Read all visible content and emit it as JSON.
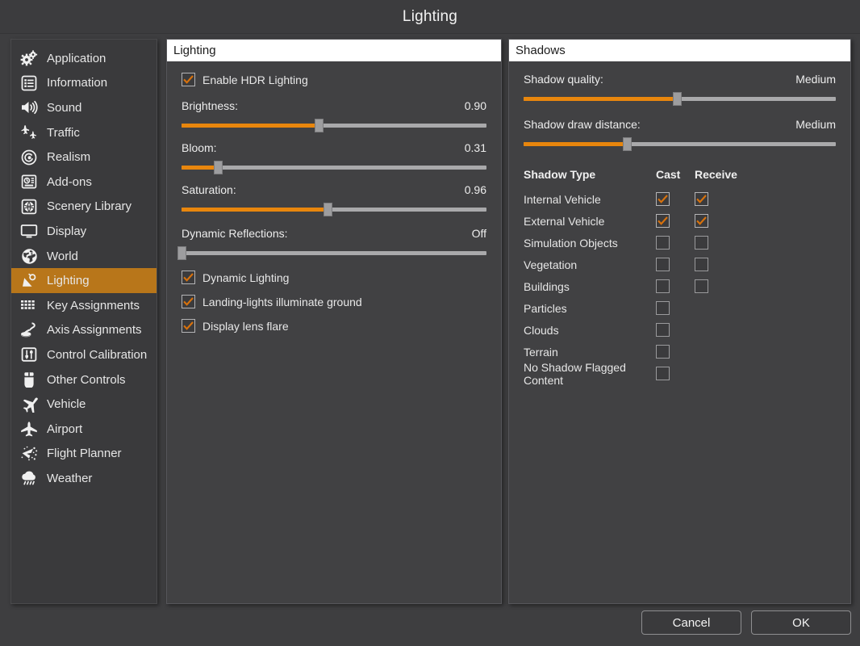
{
  "window": {
    "title": "Lighting"
  },
  "colors": {
    "accent": "#e8860d",
    "selected_item_bg": "#b8761a",
    "panel_bg": "#414143",
    "window_bg": "#3e3e40",
    "text": "#e8e8e8"
  },
  "sidebar": {
    "items": [
      {
        "label": "Application",
        "icon": "gears-icon",
        "selected": false
      },
      {
        "label": "Information",
        "icon": "list-document-icon",
        "selected": false
      },
      {
        "label": "Sound",
        "icon": "speaker-icon",
        "selected": false
      },
      {
        "label": "Traffic",
        "icon": "aircraft-traffic-icon",
        "selected": false
      },
      {
        "label": "Realism",
        "icon": "spiral-circle-icon",
        "selected": false
      },
      {
        "label": "Add-ons",
        "icon": "addons-box-icon",
        "selected": false
      },
      {
        "label": "Scenery Library",
        "icon": "globe-square-icon",
        "selected": false
      },
      {
        "label": "Display",
        "icon": "monitor-icon",
        "selected": false
      },
      {
        "label": "World",
        "icon": "globe-icon",
        "selected": false
      },
      {
        "label": "Lighting",
        "icon": "lamp-icon",
        "selected": true
      },
      {
        "label": "Key Assignments",
        "icon": "keyboard-icon",
        "selected": false
      },
      {
        "label": "Axis Assignments",
        "icon": "joystick-icon",
        "selected": false
      },
      {
        "label": "Control Calibration",
        "icon": "sliders-icon",
        "selected": false
      },
      {
        "label": "Other Controls",
        "icon": "mouse-icon",
        "selected": false
      },
      {
        "label": "Vehicle",
        "icon": "airplane-tilted-icon",
        "selected": false
      },
      {
        "label": "Airport",
        "icon": "airplane-icon",
        "selected": false
      },
      {
        "label": "Flight Planner",
        "icon": "flight-planner-icon",
        "selected": false
      },
      {
        "label": "Weather",
        "icon": "rain-cloud-icon",
        "selected": false
      }
    ]
  },
  "lighting_panel": {
    "header": "Lighting",
    "enable_hdr": {
      "label": "Enable HDR Lighting",
      "checked": true
    },
    "sliders": [
      {
        "label": "Brightness:",
        "value_text": "0.90",
        "percent": 45
      },
      {
        "label": "Bloom:",
        "value_text": "0.31",
        "percent": 12
      },
      {
        "label": "Saturation:",
        "value_text": "0.96",
        "percent": 48
      },
      {
        "label": "Dynamic Reflections:",
        "value_text": "Off",
        "percent": 0
      }
    ],
    "checkboxes": [
      {
        "label": "Dynamic Lighting",
        "checked": true
      },
      {
        "label": "Landing-lights illuminate ground",
        "checked": true
      },
      {
        "label": "Display lens flare",
        "checked": true
      }
    ]
  },
  "shadows_panel": {
    "header": "Shadows",
    "sliders": [
      {
        "label": "Shadow quality:",
        "value_text": "Medium",
        "percent": 49
      },
      {
        "label": "Shadow draw distance:",
        "value_text": "Medium",
        "percent": 33
      }
    ],
    "table": {
      "columns": [
        "Shadow Type",
        "Cast",
        "Receive"
      ],
      "rows": [
        {
          "name": "Internal Vehicle",
          "cast": true,
          "receive": true,
          "has_receive": true
        },
        {
          "name": "External Vehicle",
          "cast": true,
          "receive": true,
          "has_receive": true
        },
        {
          "name": "Simulation Objects",
          "cast": false,
          "receive": false,
          "has_receive": true
        },
        {
          "name": "Vegetation",
          "cast": false,
          "receive": false,
          "has_receive": true
        },
        {
          "name": "Buildings",
          "cast": false,
          "receive": false,
          "has_receive": true
        },
        {
          "name": "Particles",
          "cast": false,
          "receive": false,
          "has_receive": false
        },
        {
          "name": "Clouds",
          "cast": false,
          "receive": false,
          "has_receive": false
        },
        {
          "name": "Terrain",
          "cast": false,
          "receive": false,
          "has_receive": false
        },
        {
          "name": "No Shadow Flagged Content",
          "cast": false,
          "receive": false,
          "has_receive": false
        }
      ]
    }
  },
  "footer": {
    "cancel_label": "Cancel",
    "ok_label": "OK"
  }
}
